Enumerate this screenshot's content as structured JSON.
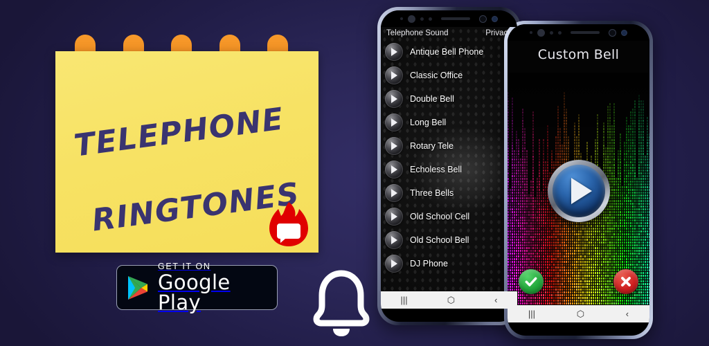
{
  "theme": {
    "bg_dark": "#1a1638",
    "bg_glow": "#332e66",
    "note_yellow": "#f7e264",
    "note_tab_orange": "#f08c20",
    "title_purple": "#3a3470",
    "flame_red": "#e00000",
    "accent_green": "#23a83c",
    "accent_red": "#cf2020",
    "play_blue": "#2b66ad"
  },
  "note": {
    "title_line1": "TELEPHONE",
    "title_line2": "RINGTONES",
    "tabs_count": 5,
    "badge_icon": "flame-chat-icon"
  },
  "store_badge": {
    "icon": "google-play-triangle-icon",
    "line1": "GET IT ON",
    "line2": "Google Play"
  },
  "bell": {
    "icon": "bell-icon"
  },
  "phone_left": {
    "app_bar": {
      "title": "Telephone Sound",
      "action": "Privacy"
    },
    "ringtones": [
      {
        "name": "Antique Bell Phone",
        "play_icon": "play-icon"
      },
      {
        "name": "Classic Office",
        "play_icon": "play-icon"
      },
      {
        "name": "Double Bell",
        "play_icon": "play-icon"
      },
      {
        "name": "Long Bell",
        "play_icon": "play-icon"
      },
      {
        "name": "Rotary Tele",
        "play_icon": "play-icon"
      },
      {
        "name": "Echoless Bell",
        "play_icon": "play-icon"
      },
      {
        "name": "Three Bells",
        "play_icon": "play-icon"
      },
      {
        "name": "Old School Cell",
        "play_icon": "play-icon"
      },
      {
        "name": "Old School Bell",
        "play_icon": "play-icon"
      },
      {
        "name": "DJ Phone",
        "play_icon": "play-icon"
      }
    ],
    "nav": {
      "recents": "|||",
      "home": "⬡",
      "back": "‹"
    }
  },
  "phone_right": {
    "title": "Custom Bell",
    "play_icon": "play-icon",
    "confirm_icon": "check-icon",
    "cancel_icon": "cross-icon",
    "nav": {
      "recents": "|||",
      "home": "⬡",
      "back": "‹"
    }
  }
}
